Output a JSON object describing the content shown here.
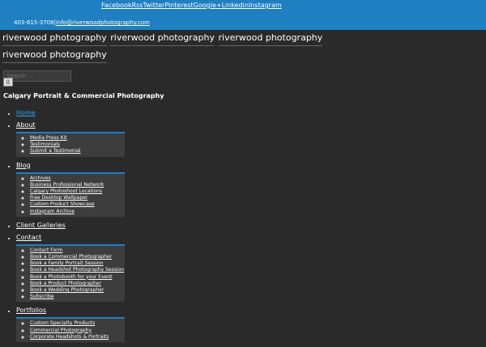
{
  "topbar": {
    "social_links": [
      "Facebook",
      "Rss",
      "Twitter",
      "Pinterest",
      "Google+",
      "Linkedin",
      "Instagram"
    ],
    "phone": "403-615-3708",
    "separator": "|",
    "email": "info@riverwoodphotography.com"
  },
  "header": {
    "logo_text": "riverwood photography"
  },
  "search": {
    "placeholder": "Search ...",
    "button_label": "ß"
  },
  "tagline": "Calgary Portrait & Commercial Photography",
  "nav": [
    {
      "label": "Home",
      "current": true,
      "children": []
    },
    {
      "label": "About",
      "current": false,
      "children": [
        "Media Press Kit",
        "Testimonials",
        "Submit a Testimonial"
      ]
    },
    {
      "label": "Blog",
      "current": false,
      "children": [
        "Archives",
        "Business Professional Network",
        "Calgary Photoshoot Locations",
        "Free Desktop Wallpaper",
        "Custom Product Showcase",
        "Instagram Archive"
      ]
    },
    {
      "label": "Client Galleries",
      "current": false,
      "children": []
    },
    {
      "label": "Contact",
      "current": false,
      "children": [
        "Contact Form",
        "Book a Commercial Photographer",
        "Book a Family Portrait Session",
        "Book a Headshot Photography Session",
        "Book a Photobooth for your Event",
        "Book a Product Photographer",
        "Book a Wedding Photographer",
        "Subscribe"
      ]
    },
    {
      "label": "Portfolios",
      "current": false,
      "children": [
        "Custom Specialty Products",
        "Commercial Photography",
        "Corporate Headshots & Portraits"
      ]
    }
  ],
  "colors": {
    "background": "#2a2a2a",
    "topbar": "#1f7fc1",
    "current_link": "#2aa3e6"
  }
}
